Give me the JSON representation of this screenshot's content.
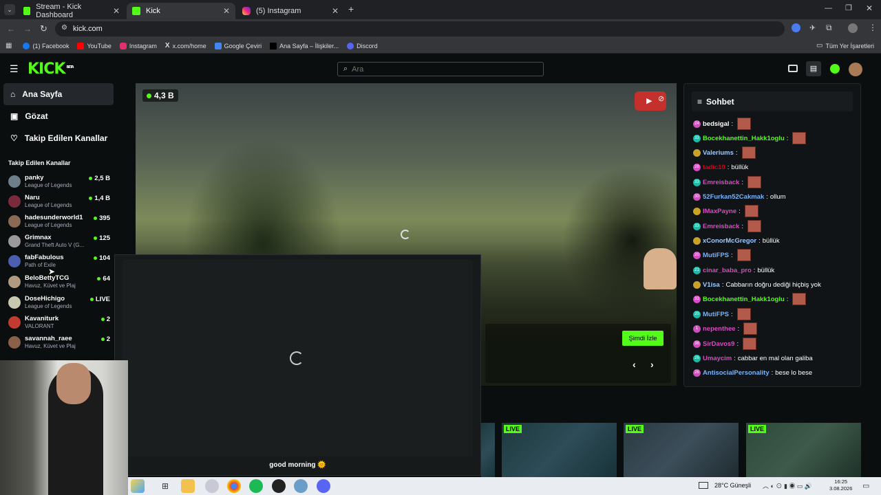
{
  "browser": {
    "tabs": [
      {
        "title": "Stream - Kick Dashboard",
        "icon": "kick-icon"
      },
      {
        "title": "Kick",
        "icon": "kick-icon"
      },
      {
        "title": "(5) Instagram",
        "icon": "instagram-icon"
      }
    ],
    "url": "kick.com",
    "bookmarks": [
      {
        "label": "(1) Facebook",
        "color": "#1877f2"
      },
      {
        "label": "YouTube",
        "color": "#ff0000"
      },
      {
        "label": "Instagram",
        "color": "#e1306c"
      },
      {
        "label": "x.com/home",
        "color": "#ffffff"
      },
      {
        "label": "Google Çeviri",
        "color": "#4285f4"
      },
      {
        "label": "Ana Sayfa – İlişkiler...",
        "color": "#000000"
      },
      {
        "label": "Discord",
        "color": "#5865f2"
      }
    ],
    "all_bookmarks": "Tüm Yer İşaretleri"
  },
  "kick": {
    "logo": "KICK",
    "logo_tag": "BETA",
    "search_placeholder": "Ara",
    "brand_color": "#53fc18",
    "nav": [
      {
        "label": "Ana Sayfa",
        "icon": "home-icon"
      },
      {
        "label": "Gözat",
        "icon": "browse-icon"
      },
      {
        "label": "Takip Edilen Kanallar",
        "icon": "heart-icon"
      }
    ],
    "followed_title": "Takip Edilen Kanallar",
    "channels": [
      {
        "name": "panky",
        "game": "League of Legends",
        "viewers": "2,5 B"
      },
      {
        "name": "Naru",
        "game": "League of Legends",
        "viewers": "1,4 B"
      },
      {
        "name": "hadesunderworld1",
        "game": "League of Legends",
        "viewers": "395"
      },
      {
        "name": "Grimnax",
        "game": "Grand Theft Auto V (G...",
        "viewers": "125"
      },
      {
        "name": "fabFabulous",
        "game": "Path of Exile",
        "viewers": "104"
      },
      {
        "name": "BeloBettyTCG",
        "game": "Havuz, Küvet ve Plaj",
        "viewers": "64"
      },
      {
        "name": "DoseHichigo",
        "game": "League of Legends",
        "viewers": "LIVE"
      },
      {
        "name": "Kavaniturk",
        "game": "VALORANT",
        "viewers": "2"
      },
      {
        "name": "savannah_raee",
        "game": "Havuz, Küvet ve Plaj",
        "viewers": "2"
      }
    ]
  },
  "player": {
    "viewers": "4,3 B",
    "watch_label": "Şimdi İzle"
  },
  "overlay": {
    "caption": "good morning 🌞"
  },
  "chat": {
    "title": "Sohbet",
    "messages": [
      {
        "badge": "24",
        "user": "bedsigal",
        "color": "#ffffff",
        "text": "",
        "emote": true
      },
      {
        "badge": "33",
        "user": "Bocekhanettin_Hakk1oglu",
        "color": "#53fc18",
        "text": "",
        "emote": true
      },
      {
        "badge": "",
        "user": "Valeriums",
        "color": "#9ecbff",
        "text": "",
        "emote": true
      },
      {
        "badge": "28",
        "user": "tadic10",
        "color": "#d0021b",
        "text": "büllük",
        "emote": false
      },
      {
        "badge": "33",
        "user": "Emreisback",
        "color": "#d34cc0",
        "text": "",
        "emote": true
      },
      {
        "badge": "30",
        "user": "52Furkan52Cakmak",
        "color": "#75b4ff",
        "text": "ollum",
        "emote": false
      },
      {
        "badge": "",
        "user": "IMaxPayne",
        "color": "#d34cc0",
        "text": "",
        "emote": true
      },
      {
        "badge": "33",
        "user": "Emreisback",
        "color": "#d34cc0",
        "text": "",
        "emote": true
      },
      {
        "badge": "",
        "user": "xConorMcGregor",
        "color": "#9ecbff",
        "text": "büllük",
        "emote": false
      },
      {
        "badge": "20",
        "user": "MutiFPS",
        "color": "#75b4ff",
        "text": "",
        "emote": true
      },
      {
        "badge": "21",
        "user": "cinar_baba_pro",
        "color": "#d34cc0",
        "text": "büllük",
        "emote": false
      },
      {
        "badge": "",
        "user": "V1isa",
        "color": "#9ecbff",
        "text": "Cabbarın doğru dediği hiçbiş yok",
        "emote": false
      },
      {
        "badge": "33",
        "user": "Bocekhanettin_Hakk1oglu",
        "color": "#53fc18",
        "text": "",
        "emote": true
      },
      {
        "badge": "20",
        "user": "MutiFPS",
        "color": "#75b4ff",
        "text": "",
        "emote": true
      },
      {
        "badge": "1",
        "user": "nepenthee",
        "color": "#d34cc0",
        "text": "",
        "emote": true
      },
      {
        "badge": "36",
        "user": "SirDavos9",
        "color": "#d34cc0",
        "text": "",
        "emote": true
      },
      {
        "badge": "26",
        "user": "Umaycim",
        "color": "#d34cc0",
        "text": "cabbar en mal olan galiba",
        "emote": false
      },
      {
        "badge": "26",
        "user": "AntisocialPersonality",
        "color": "#75b4ff",
        "text": "bese lo bese",
        "emote": false
      }
    ]
  },
  "thumbnails": [
    {
      "label": "LIVE"
    },
    {
      "label": "LIVE"
    },
    {
      "label": "LIVE"
    }
  ],
  "taskbar": {
    "weather": "28°C  Güneşli",
    "time": "16:25",
    "date": "3.08.2026"
  }
}
